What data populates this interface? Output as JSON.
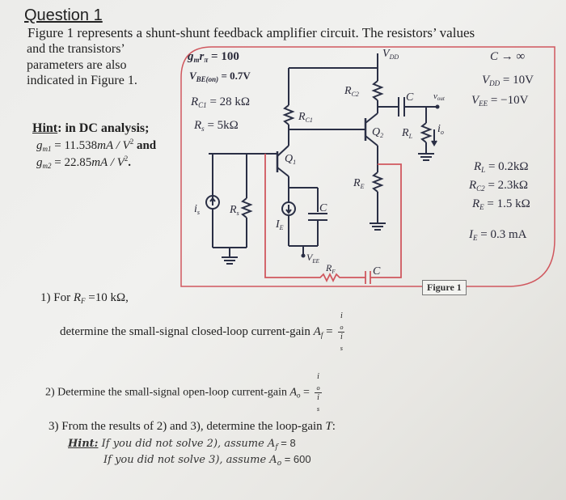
{
  "question": {
    "title": "Question 1",
    "intro_line1": "Figure 1 represents a shunt-shunt feedback amplifier circuit. The resistors’ values",
    "intro_line2": "and    the    transistors’",
    "intro_line3": "parameters   are   also",
    "intro_line4": "indicated in Figure 1."
  },
  "hint_dc": {
    "label": "Hint",
    "text": ": in DC analysis;",
    "gm1_sym": "g",
    "gm1_sub": "m1",
    "gm1_value": " = 11.538",
    "gm1_unit": "mA / V",
    "gm1_tail": " and",
    "gm2_sym": "g",
    "gm2_sub": "m2",
    "gm2_value": " = 22.85",
    "gm2_unit": "mA / V",
    "gm2_tail": "."
  },
  "figure": {
    "params_left": [
      {
        "sym": "g",
        "sub": "m",
        "extra": "r",
        "extra_sub": "π",
        "value": " = 100"
      },
      {
        "sym": "V",
        "sub": "BE(on)",
        "value": " = 0.7V"
      },
      {
        "sym": "R",
        "sub": "C1",
        "value": " = 28 kΩ"
      },
      {
        "sym": "R",
        "sub": "s",
        "value": " = 5kΩ"
      }
    ],
    "params_right_top": [
      {
        "text": "C → ∞"
      },
      {
        "sym": "V",
        "sub": "DD",
        "value": " = 10V"
      },
      {
        "sym": "V",
        "sub": "EE",
        "value": " = −10V"
      }
    ],
    "params_right_bottom": [
      {
        "sym": "R",
        "sub": "L",
        "value": " = 0.2kΩ"
      },
      {
        "sym": "R",
        "sub": "C2",
        "value": " = 2.3kΩ"
      },
      {
        "sym": "R",
        "sub": "E",
        "value": " = 1.5 kΩ"
      },
      {
        "sym": "I",
        "sub": "E",
        "value": " = 0.3 mA"
      }
    ],
    "circuit_labels": {
      "vdd": "V",
      "vdd_sub": "DD",
      "rc1": "R",
      "rc1_sub": "C1",
      "rc2": "R",
      "rc2_sub": "C2",
      "c": "C",
      "vout": "v",
      "vout_sub": "out",
      "q1": "Q",
      "q1_sub": "1",
      "q2": "Q",
      "q2_sub": "2",
      "rl": "R",
      "rl_sub": "L",
      "io": "i",
      "io_sub": "o",
      "re": "R",
      "re_sub": "E",
      "is": "i",
      "is_sub": "s",
      "rs": "R",
      "rs_sub": "s",
      "ie": "I",
      "ie_sub": "E",
      "vee": "V",
      "vee_sub": "EE",
      "rf": "R",
      "rf_sub": "F"
    },
    "caption": "Figure 1"
  },
  "parts": {
    "p1_line1_pre": "1)  For ",
    "p1_rf_sym": "R",
    "p1_rf_sub": "F",
    "p1_line1_post": " =10 kΩ,",
    "p1_line2": "determine the small-signal closed-loop current-gain ",
    "p1_gain_sym": "A",
    "p1_gain_sub": "f",
    "p2_line": "2)  Determine the small-signal open-loop current-gain ",
    "p2_gain_sym": "A",
    "p2_gain_sub": "o",
    "frac_num": "i",
    "frac_num_sub": "o",
    "frac_den": "i",
    "frac_den_sub": "s",
    "p3_line": "3)  From the results of 2) and 3), determine the loop-gain ",
    "p3_T": "T",
    "p3_colon": ":",
    "hint_label": "Hint:",
    "hint1_text": " If you did not solve 2), assume  ",
    "hint1_sym": "A",
    "hint1_sub": "f",
    "hint1_value": " = 8",
    "hint2_text": "If you did not solve 3), assume  ",
    "hint2_sym": "A",
    "hint2_sub": "o",
    "hint2_value": " = 600"
  },
  "colors": {
    "feedback_wire": "#d0575e",
    "circuit_wire": "#2a2f45"
  }
}
